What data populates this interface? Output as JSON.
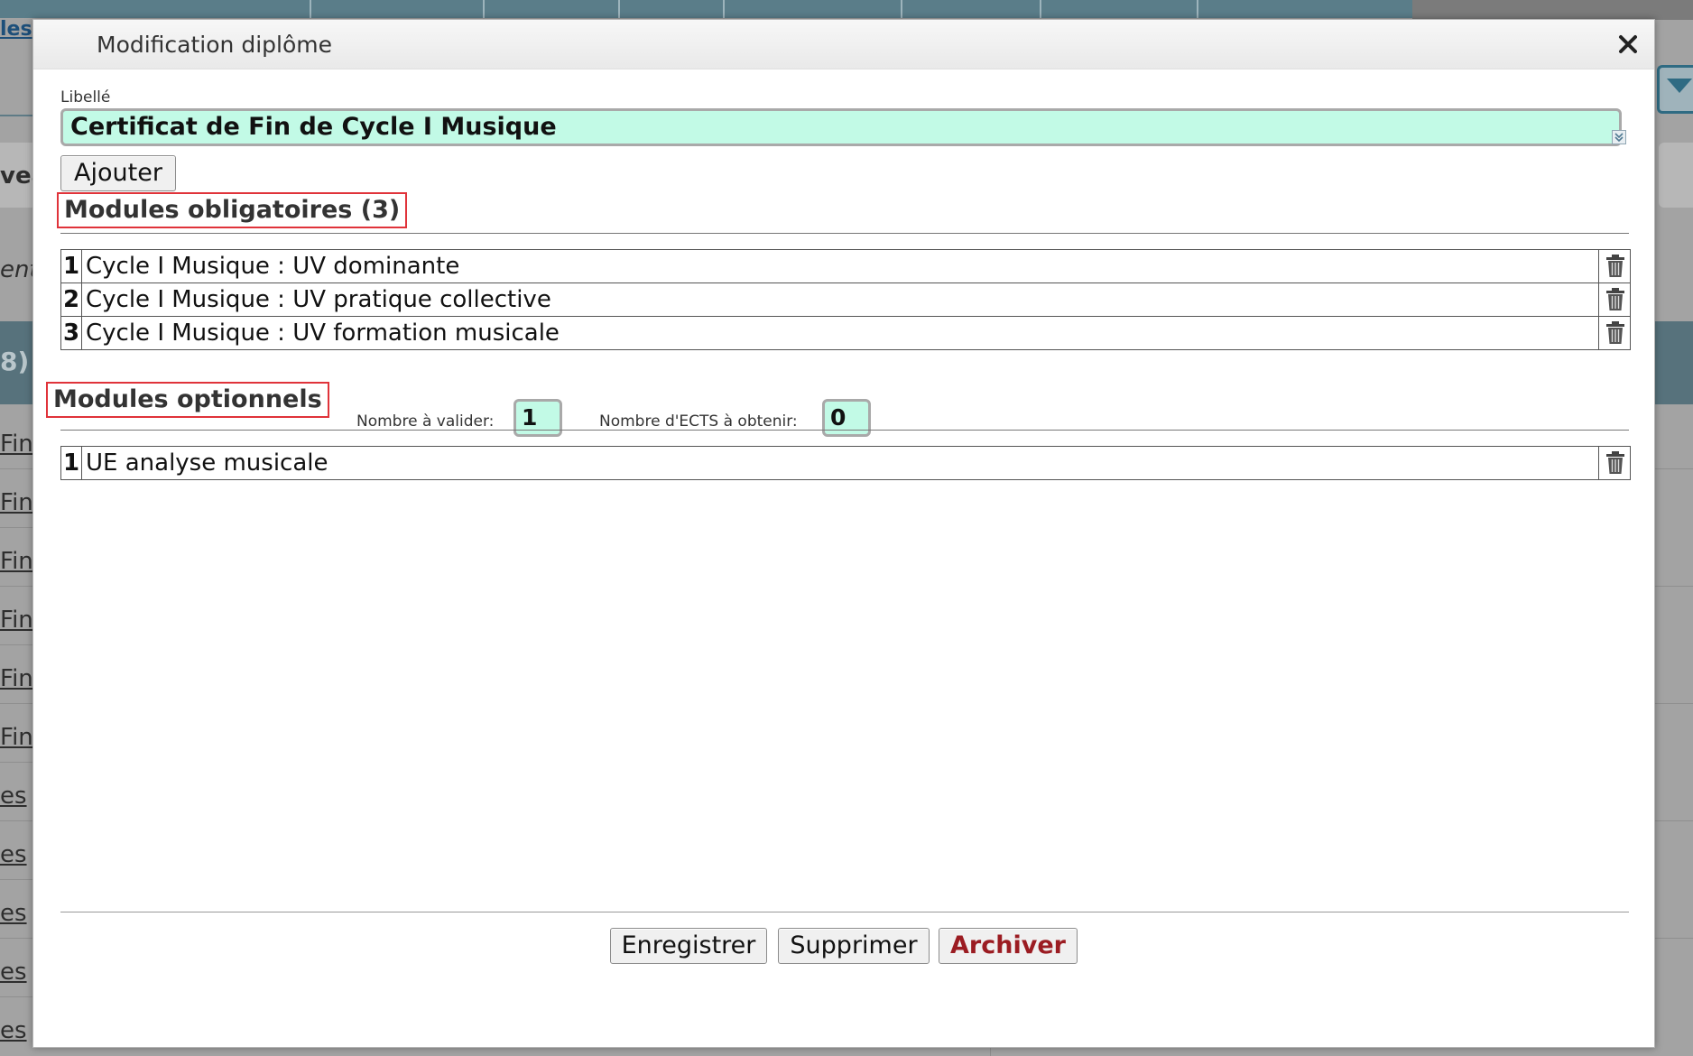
{
  "background": {
    "nav_link": "les",
    "left_fragments": [
      {
        "text": "vea",
        "style": "bold"
      },
      {
        "text": "ent",
        "style": "italic"
      },
      {
        "text": "8)",
        "style": "band"
      },
      {
        "text": "Fin",
        "style": "link"
      },
      {
        "text": "Fin",
        "style": "link"
      },
      {
        "text": "Fin",
        "style": "link"
      },
      {
        "text": "Fin",
        "style": "link"
      },
      {
        "text": "Fin",
        "style": "link"
      },
      {
        "text": "Fin",
        "style": "link"
      },
      {
        "text": "es",
        "style": "link"
      },
      {
        "text": "es",
        "style": "link"
      },
      {
        "text": "es",
        "style": "link"
      },
      {
        "text": "es",
        "style": "link"
      },
      {
        "text": "es",
        "style": "link"
      }
    ]
  },
  "dialog": {
    "title": "Modification diplôme",
    "close_icon": "close-icon",
    "libelle": {
      "label": "Libellé",
      "value": "Certificat de Fin de Cycle I Musique"
    },
    "add_button": "Ajouter",
    "mandatory": {
      "title": "Modules obligatoires (3)",
      "rows": [
        {
          "num": "1",
          "label": "Cycle I Musique : UV dominante"
        },
        {
          "num": "2",
          "label": "Cycle I Musique : UV pratique collective"
        },
        {
          "num": "3",
          "label": "Cycle I Musique : UV formation musicale"
        }
      ]
    },
    "optional": {
      "title": "Modules optionnels",
      "validate_label": "Nombre à valider:",
      "validate_value": "1",
      "ects_label": "Nombre d'ECTS à obtenir:",
      "ects_value": "0",
      "rows": [
        {
          "num": "1",
          "label": "UE analyse musicale"
        }
      ]
    },
    "buttons": {
      "save": "Enregistrer",
      "delete": "Supprimer",
      "archive": "Archiver"
    }
  },
  "colors": {
    "input_bg": "#c2fae6",
    "highlight_border": "#e0333a",
    "archive_text": "#9b1c22",
    "header_bar": "#5a7d89"
  }
}
